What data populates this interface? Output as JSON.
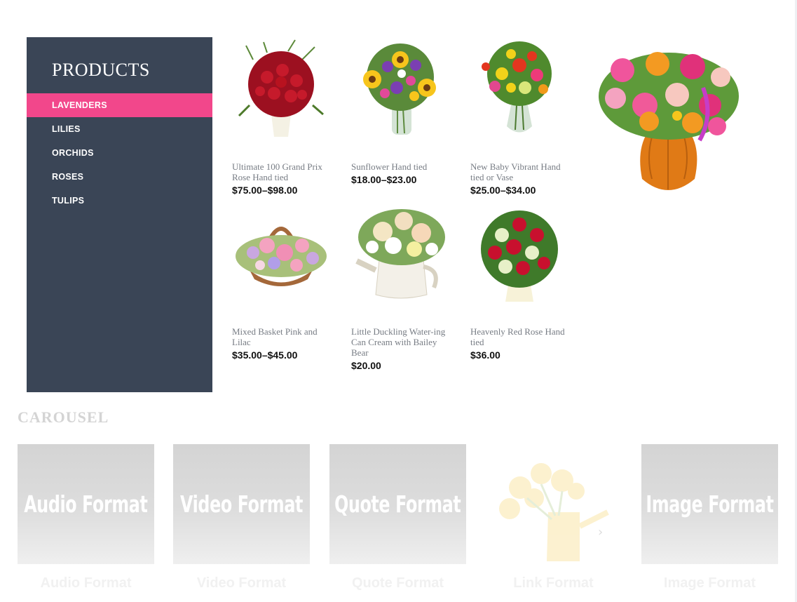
{
  "sidebar": {
    "title": "PRODUCTS",
    "items": [
      {
        "label": "LAVENDERS",
        "active": true
      },
      {
        "label": "LILIES"
      },
      {
        "label": "ORCHIDS"
      },
      {
        "label": "ROSES"
      },
      {
        "label": "TULIPS"
      }
    ],
    "background": "#3a4556",
    "accent": "#f2478b"
  },
  "products": [
    {
      "name": "Ultimate 100 Grand Prix Rose Hand tied",
      "price": "$75.00–$98.00",
      "image": "red-rose-bouquet-image"
    },
    {
      "name": "Sunflower Hand tied",
      "price": "$18.00–$23.00",
      "image": "sunflower-bouquet-image"
    },
    {
      "name": "New Baby Vibrant Hand tied or Vase",
      "price": "$25.00–$34.00",
      "image": "vibrant-vase-bouquet-image"
    },
    {
      "name": "Mixed Basket Pink and Lilac",
      "price": "$35.00–$45.00",
      "image": "pink-basket-image"
    },
    {
      "name": "Little Duckling Water-ing Can Cream with Bailey Bear",
      "price": "$20.00",
      "image": "watering-can-bouquet-image"
    },
    {
      "name": "Heavenly Red Rose Hand tied",
      "price": "$36.00",
      "image": "red-white-rose-bouquet-image"
    }
  ],
  "featured_image": "orange-vase-bouquet-image",
  "carousel": {
    "title": "CAROUSEL",
    "items": [
      {
        "card_text": "Audio Format",
        "caption": "Audio Format"
      },
      {
        "card_text": "Video Format",
        "caption": "Video Format"
      },
      {
        "card_text": "Quote Format",
        "caption": "Quote Format"
      },
      {
        "card_text": "",
        "caption": "Link Format",
        "image": "yellow-tulip-watering-can-image"
      },
      {
        "card_text": "Image Format",
        "caption": "Image Format"
      }
    ],
    "next_icon": "chevron-right-icon"
  }
}
